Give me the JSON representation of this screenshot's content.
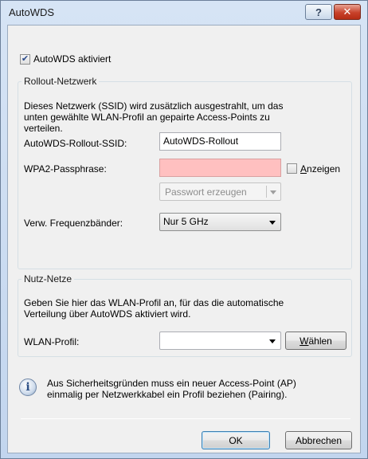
{
  "window": {
    "title": "AutoWDS",
    "help_glyph": "?",
    "close_glyph": "✕"
  },
  "autowds_checkbox": {
    "label": "AutoWDS aktiviert",
    "checked": true
  },
  "rollout": {
    "group_title": "Rollout-Netzwerk",
    "description_lines": [
      "Dieses Netzwerk (SSID) wird zusätzlich ausgestrahlt, um das",
      "unten gewählte WLAN-Profil an gepairte Access-Points zu",
      "verteilen."
    ],
    "ssid_label": "AutoWDS-Rollout-SSID:",
    "ssid_value": "AutoWDS-Rollout",
    "passphrase_label": "WPA2-Passphrase:",
    "passphrase_value": "",
    "show_checkbox_label": "Anzeigen",
    "show_checked": false,
    "generate_button_label": "Passwort erzeugen",
    "freq_label": "Verw. Frequenzbänder:",
    "freq_value": "Nur 5 GHz"
  },
  "nutz": {
    "group_title": "Nutz-Netze",
    "description_lines": [
      "Geben Sie hier das WLAN-Profil an, für das die automatische",
      "Verteilung über AutoWDS aktiviert wird."
    ],
    "profile_label": "WLAN-Profil:",
    "profile_value": "",
    "choose_button_label": "Wählen"
  },
  "info": {
    "icon": "info-icon",
    "lines": [
      "Aus Sicherheitsgründen muss ein neuer Access-Point (AP)",
      "einmalig per Netzwerkkabel ein Profil beziehen (Pairing)."
    ]
  },
  "footer": {
    "ok_label": "OK",
    "cancel_label": "Abbrechen"
  }
}
